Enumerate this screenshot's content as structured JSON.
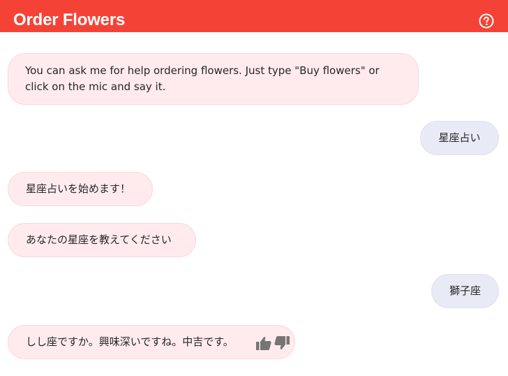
{
  "toolbar": {
    "title": "Order Flowers",
    "help_icon": "help-circle-icon",
    "background": "#f44336"
  },
  "messages": [
    {
      "from": "bot",
      "text": "You can ask me for help ordering flowers. Just type \"Buy flowers\" or click on the mic and say it."
    },
    {
      "from": "user",
      "text": "星座占い"
    },
    {
      "from": "bot",
      "text": "星座占いを始めます！"
    },
    {
      "from": "bot",
      "text": "あなたの星座を教えてください"
    },
    {
      "from": "user",
      "text": "獅子座"
    },
    {
      "from": "bot",
      "text": "しし座ですか。興味深いですね。中吉です。"
    }
  ],
  "feedback": {
    "up_icon": "thumb-up-icon",
    "down_icon": "thumb-down-icon"
  },
  "colors": {
    "bot_bubble": "#ffebee",
    "user_bubble": "#e8eaf6",
    "text": "#262626"
  }
}
